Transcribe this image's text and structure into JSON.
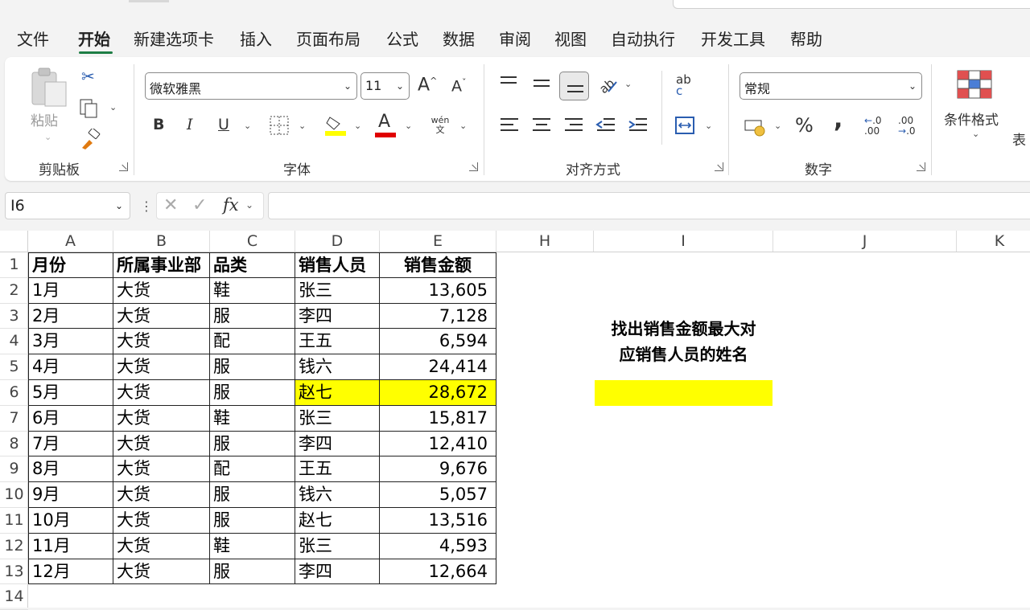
{
  "menu": {
    "items": [
      "文件",
      "开始",
      "新建选项卡",
      "插入",
      "页面布局",
      "公式",
      "数据",
      "审阅",
      "视图",
      "自动执行",
      "开发工具",
      "帮助"
    ],
    "active": "开始"
  },
  "ribbon": {
    "clipboard": {
      "paste_label": "粘贴",
      "group_label": "剪贴板"
    },
    "font": {
      "font_name": "微软雅黑",
      "font_size": "11",
      "grow_label": "A",
      "shrink_label": "A",
      "bold": "B",
      "italic": "I",
      "underline": "U",
      "fill_color": "#ffff00",
      "font_color": "#e00000",
      "font_color_label": "A",
      "phonetic_top": "wén",
      "phonetic_bottom": "文",
      "group_label": "字体"
    },
    "alignment": {
      "group_label": "对齐方式",
      "wrap_top": "ab",
      "wrap_bottom": "c"
    },
    "number": {
      "format": "常规",
      "percent": "%",
      "comma": ",",
      "inc_top": ".0",
      "inc_bottom": ".00",
      "dec_top": ".00",
      "dec_bottom": ".0",
      "group_label": "数字"
    },
    "styles": {
      "cond_format_label": "条件格式",
      "table_label_partial": "表"
    }
  },
  "formula_bar": {
    "name_box": "I6",
    "fx": "fx",
    "formula": ""
  },
  "columns": [
    "A",
    "B",
    "C",
    "D",
    "E",
    "H",
    "I",
    "J",
    "K"
  ],
  "rows": [
    "1",
    "2",
    "3",
    "4",
    "5",
    "6",
    "7",
    "8",
    "9",
    "10",
    "11",
    "12",
    "13",
    "14"
  ],
  "table": {
    "headers": [
      "月份",
      "所属事业部",
      "品类",
      "销售人员",
      "销售金额"
    ],
    "rows": [
      [
        "1月",
        "大货",
        "鞋",
        "张三",
        "13,605"
      ],
      [
        "2月",
        "大货",
        "服",
        "李四",
        "7,128"
      ],
      [
        "3月",
        "大货",
        "配",
        "王五",
        "6,594"
      ],
      [
        "4月",
        "大货",
        "服",
        "钱六",
        "24,414"
      ],
      [
        "5月",
        "大货",
        "服",
        "赵七",
        "28,672"
      ],
      [
        "6月",
        "大货",
        "鞋",
        "张三",
        "15,817"
      ],
      [
        "7月",
        "大货",
        "服",
        "李四",
        "12,410"
      ],
      [
        "8月",
        "大货",
        "配",
        "王五",
        "9,676"
      ],
      [
        "9月",
        "大货",
        "服",
        "钱六",
        "5,057"
      ],
      [
        "10月",
        "大货",
        "服",
        "赵七",
        "13,516"
      ],
      [
        "11月",
        "大货",
        "鞋",
        "张三",
        "4,593"
      ],
      [
        "12月",
        "大货",
        "服",
        "李四",
        "12,664"
      ]
    ],
    "highlight_color": "#ffff00"
  },
  "note": {
    "line1": "找出销售金额最大对",
    "line2": "应销售人员的姓名"
  }
}
